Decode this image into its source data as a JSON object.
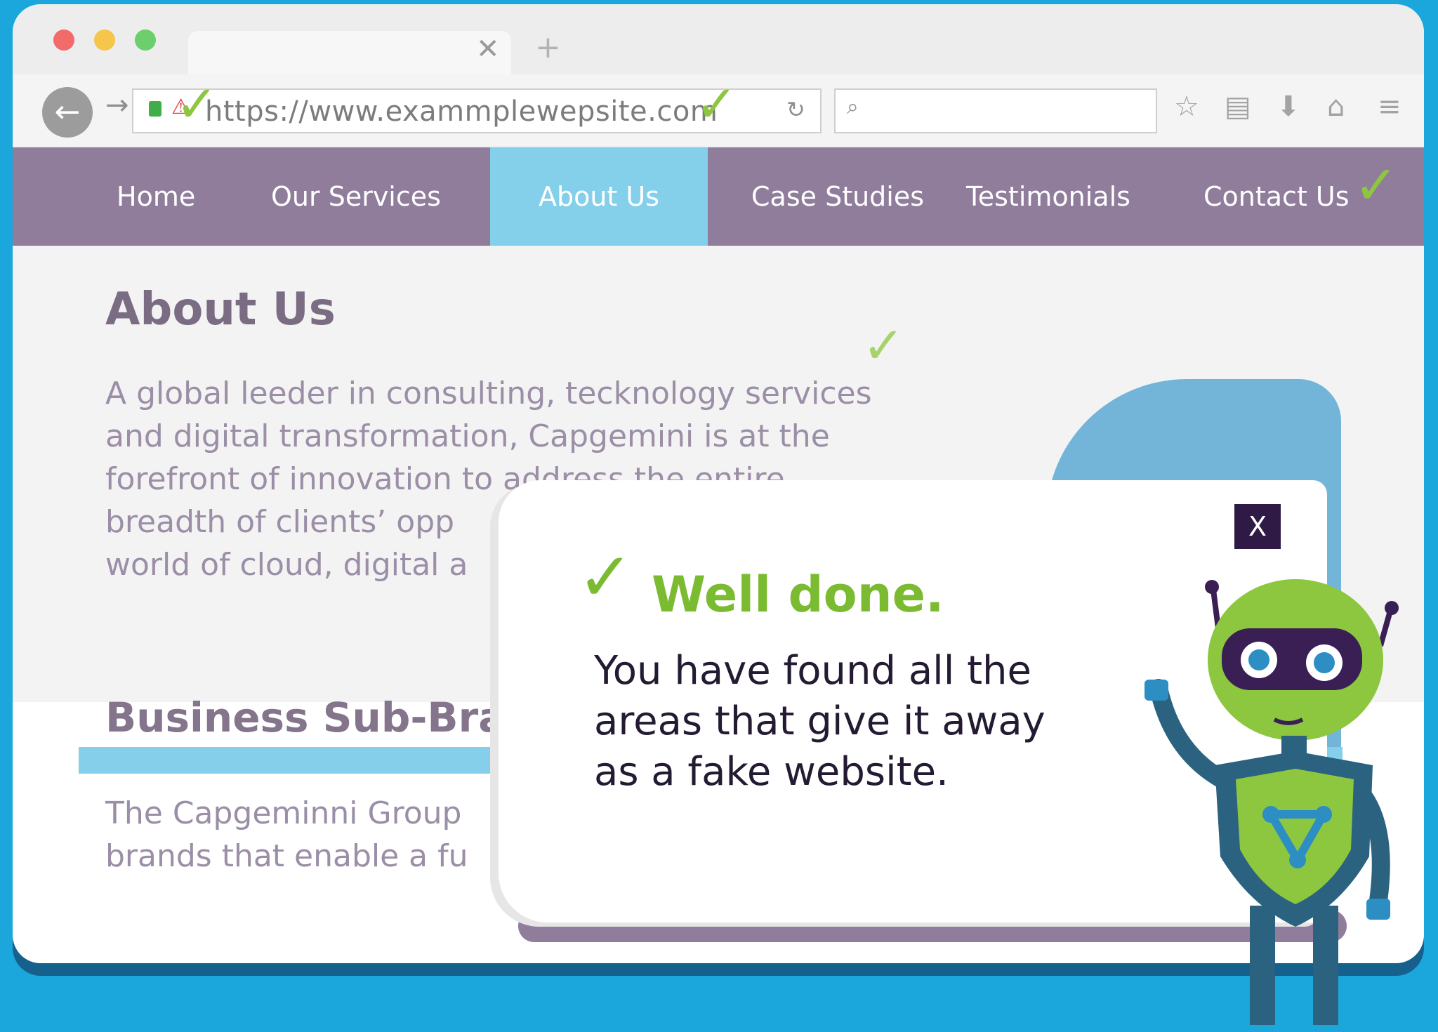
{
  "browser": {
    "tab_close": "✕",
    "new_tab": "+",
    "back": "←",
    "forward": "→",
    "url": "https://www.exammplewepsite.com",
    "reload": "↻",
    "search_glyph": "⌕",
    "toolbar_icons": [
      "star-icon",
      "clipboard-icon",
      "download-icon",
      "home-icon",
      "menu-icon"
    ],
    "toolbar_glyphs": [
      "☆",
      "▤",
      "⬇",
      "⌂",
      "≡"
    ]
  },
  "nav": {
    "items": [
      {
        "label": "Home",
        "active": false
      },
      {
        "label": "Our Services",
        "active": false
      },
      {
        "label": "About Us",
        "active": true
      },
      {
        "label": "Case Studies",
        "active": false
      },
      {
        "label": "Testimonials",
        "active": false
      },
      {
        "label": "Contact Us",
        "active": false
      }
    ]
  },
  "page": {
    "title": "About Us",
    "paragraph": [
      "A global leeder in consulting, tecknology services",
      "and digital transformation, Capgemini is at the",
      "forefront of innovation to address the entire",
      "breadth of clients’ opp",
      "world of cloud, digital a"
    ],
    "sub_title": "Business Sub-Brar",
    "paragraph2": [
      "The Capgeminni Group",
      "brands that enable a fu"
    ]
  },
  "modal": {
    "close_label": "X",
    "check": "✓",
    "title": "Well done.",
    "body": [
      "You have found all the",
      "areas that give it away",
      "as a fake website."
    ]
  },
  "marker": "✓",
  "colors": {
    "background": "#1ba7dc",
    "nav": "#907d9c",
    "nav_active": "#84cfea",
    "check_green": "#8dc63f",
    "modal_title": "#7bbb31",
    "close_button": "#2f1a45"
  }
}
